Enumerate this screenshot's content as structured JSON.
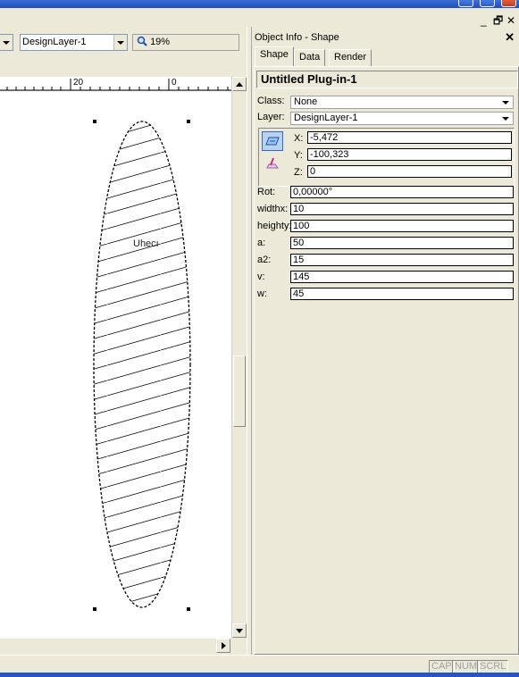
{
  "window_controls": {
    "mdi_minimize": "_",
    "mdi_restore": "🗗",
    "mdi_close": "✕"
  },
  "toolbar": {
    "layer_select": "DesignLayer-1",
    "zoom": "19%"
  },
  "ruler": {
    "tick_20": "20",
    "tick_0": "0"
  },
  "canvas": {
    "object_label": "Uhecı"
  },
  "object_info": {
    "panel_title": "Object Info - Shape",
    "close_glyph": "✕",
    "tabs": [
      {
        "label": "Shape"
      },
      {
        "label": "Data"
      },
      {
        "label": "Render"
      }
    ],
    "object_name": "Untitled Plug-in-1",
    "class_label": "Class:",
    "class_value": "None",
    "layer_label": "Layer:",
    "layer_value": "DesignLayer-1",
    "x_label": "X:",
    "x_value": "-5,472",
    "y_label": "Y:",
    "y_value": "-100,323",
    "z_label": "Z:",
    "z_value": "0",
    "params": [
      {
        "label": "Rot:",
        "value": "0,00000°"
      },
      {
        "label": "widthx:",
        "value": "10"
      },
      {
        "label": "heighty:",
        "value": "100"
      },
      {
        "label": "a:",
        "value": "50"
      },
      {
        "label": "a2:",
        "value": "15"
      },
      {
        "label": "v:",
        "value": "145"
      },
      {
        "label": "w:",
        "value": "45"
      }
    ]
  },
  "statusbar": {
    "cap": "CAP",
    "num": "NUM",
    "scrl": "SCRL"
  },
  "colors": {
    "chrome": "#ece9d8",
    "titlebar": "#2457c5",
    "selected_icon_bg": "#b9d2f0"
  }
}
